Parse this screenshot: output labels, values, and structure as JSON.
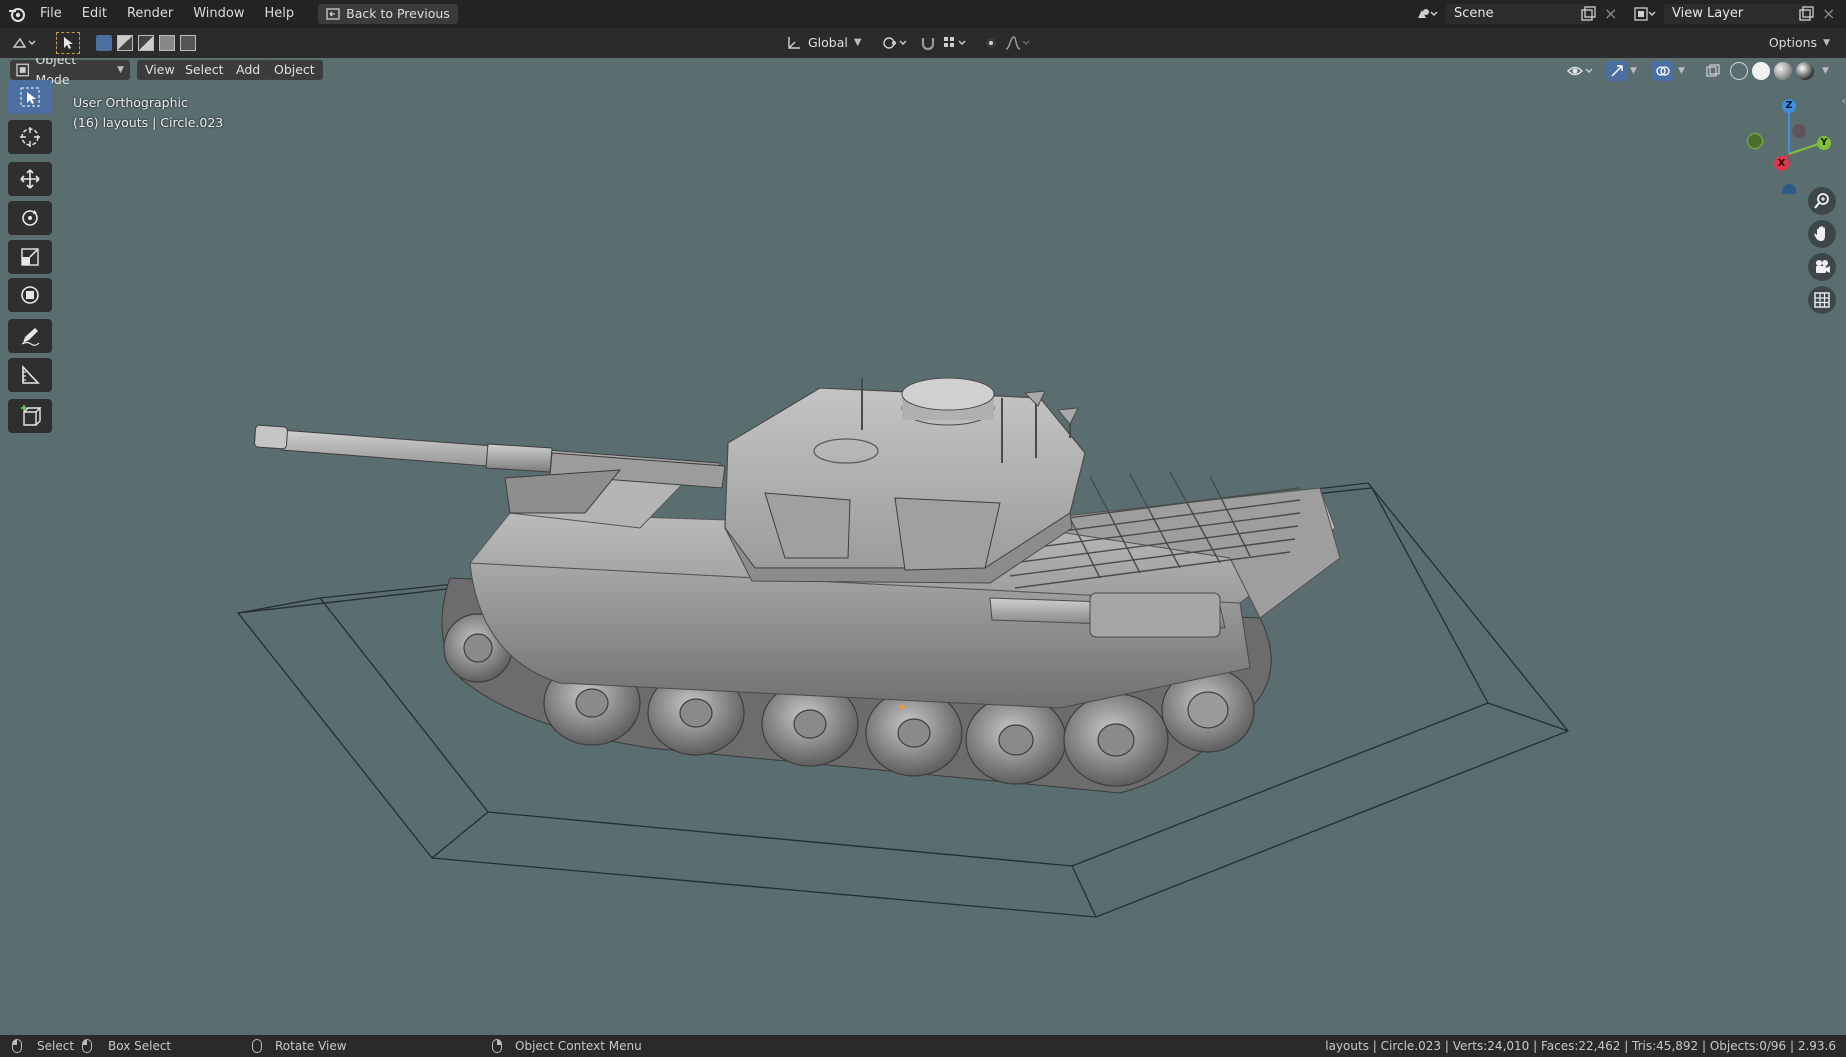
{
  "menu": {
    "file": "File",
    "edit": "Edit",
    "render": "Render",
    "window": "Window",
    "help": "Help",
    "back": "Back to Previous"
  },
  "scene": {
    "name": "Scene",
    "view_layer": "View Layer"
  },
  "toolbar": {
    "orientation": "Global",
    "options": "Options"
  },
  "viewport_header": {
    "mode": "Object Mode",
    "view": "View",
    "select": "Select",
    "add": "Add",
    "object": "Object"
  },
  "overlay": {
    "view_name": "User Orthographic",
    "collection_info": "(16) layouts | Circle.023"
  },
  "gizmo": {
    "z": "Z",
    "y": "Y",
    "x": "X"
  },
  "status": {
    "select": "Select",
    "box_select": "Box Select",
    "rotate": "Rotate View",
    "context": "Object Context Menu",
    "stats": "layouts | Circle.023 | Verts:24,010 | Faces:22,462 | Tris:45,892 | Objects:0/96 | 2.93.6"
  },
  "colors": {
    "viewport_bg": "#5a6e70",
    "active_tool": "#4a6fa0",
    "axis_x": "#e0364c",
    "axis_y": "#7fbf3a",
    "axis_z": "#3d8fe0"
  }
}
